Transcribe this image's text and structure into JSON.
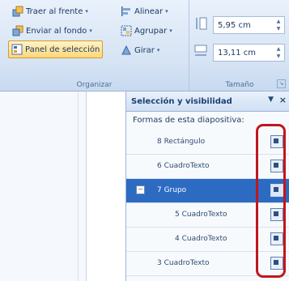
{
  "ribbon": {
    "arrange": {
      "label": "Organizar",
      "bring_front": "Traer al frente",
      "send_back": "Enviar al fondo",
      "selection_pane": "Panel de selección",
      "align": "Alinear",
      "group": "Agrupar",
      "rotate": "Girar"
    },
    "size": {
      "label": "Tamaño",
      "height": "5,95 cm",
      "width": "13,11 cm"
    }
  },
  "pane": {
    "title": "Selección y visibilidad",
    "subtitle": "Formas de esta diapositiva:",
    "items": [
      {
        "label": "8 Rectángulo",
        "level": 0,
        "selected": false
      },
      {
        "label": "6 CuadroTexto",
        "level": 0,
        "selected": false
      },
      {
        "label": "7 Grupo",
        "level": 0,
        "selected": true,
        "group": true
      },
      {
        "label": "5 CuadroTexto",
        "level": 1,
        "selected": false
      },
      {
        "label": "4 CuadroTexto",
        "level": 1,
        "selected": false
      },
      {
        "label": "3 CuadroTexto",
        "level": 0,
        "selected": false
      }
    ]
  },
  "colors": {
    "accent_selected": "#2d6bc3",
    "highlight_box": "#c0171e",
    "active_button": "#ffd77a"
  }
}
